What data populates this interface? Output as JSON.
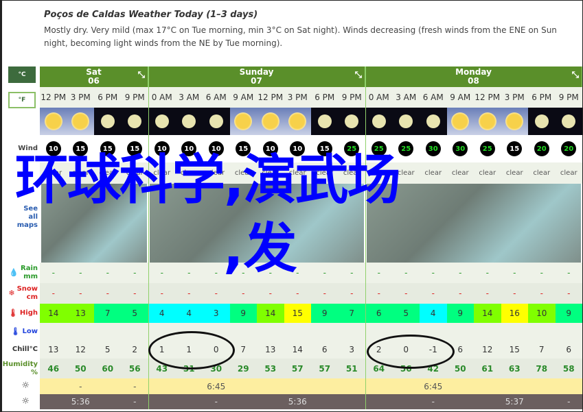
{
  "title": "Poços de Caldas Weather Today (1–3 days)",
  "description": "Mostly dry. Very mild (max 17°C on Tue morning, min 3°C on Sat night). Winds decreasing (fresh winds from the ENE on Sun night, becoming light winds from the NE by Tue morning).",
  "units": {
    "celsius": "°C",
    "fahrenheit": "°F"
  },
  "days": [
    {
      "name": "Sat",
      "date": "06"
    },
    {
      "name": "Sunday",
      "date": "07"
    },
    {
      "name": "Monday",
      "date": "08"
    }
  ],
  "times": [
    "12 PM",
    "3 PM",
    "6 PM",
    "9 PM",
    "0 AM",
    "3 AM",
    "6 AM",
    "9 AM",
    "12 PM",
    "3 PM",
    "6 PM",
    "9 PM",
    "0 AM",
    "3 AM",
    "6 AM",
    "9 AM",
    "12 PM",
    "3 PM",
    "6 PM",
    "9 PM"
  ],
  "sky": [
    "sun",
    "sun",
    "moon",
    "moon",
    "moon",
    "moon",
    "moon",
    "sun",
    "sun",
    "sun",
    "moon",
    "moon",
    "moon",
    "moon",
    "moon",
    "sun",
    "sun",
    "sun",
    "moon",
    "moon"
  ],
  "labels": {
    "wind": "Wind",
    "maps": "See all maps",
    "rain": "Rain mm",
    "snow": "Snow cm",
    "high": "High",
    "low": "Low",
    "chill": "Chill°C",
    "humidity": "Humidity %"
  },
  "wind": [
    10,
    15,
    15,
    15,
    10,
    10,
    10,
    15,
    10,
    10,
    15,
    25,
    25,
    25,
    30,
    30,
    25,
    15,
    20,
    20
  ],
  "summary": [
    "clear",
    "clear",
    "clear",
    "clear",
    "clear",
    "clear",
    "clear",
    "clear",
    "clear",
    "clear",
    "clear",
    "clear",
    "clear",
    "clear",
    "clear",
    "clear",
    "clear",
    "clear",
    "clear",
    "clear"
  ],
  "rain": [
    "-",
    "-",
    "-",
    "-",
    "-",
    "-",
    "-",
    "-",
    "-",
    "-",
    "-",
    "-",
    "-",
    "-",
    "-",
    "-",
    "-",
    "-",
    "-",
    "-"
  ],
  "snow": [
    "-",
    "-",
    "-",
    "-",
    "-",
    "-",
    "-",
    "-",
    "-",
    "-",
    "-",
    "-",
    "-",
    "-",
    "-",
    "-",
    "-",
    "-",
    "-",
    "-"
  ],
  "high": [
    14,
    13,
    7,
    5,
    4,
    4,
    3,
    9,
    14,
    15,
    9,
    7,
    6,
    5,
    4,
    9,
    14,
    16,
    10,
    9
  ],
  "chill": [
    13,
    12,
    5,
    2,
    1,
    1,
    0,
    7,
    13,
    14,
    6,
    3,
    2,
    0,
    -1,
    6,
    12,
    15,
    7,
    6
  ],
  "humidity": [
    46,
    50,
    60,
    56,
    43,
    31,
    30,
    29,
    53,
    57,
    57,
    51,
    64,
    56,
    42,
    50,
    61,
    63,
    78,
    58
  ],
  "sunrise": [
    "",
    "-",
    "",
    "-",
    "",
    "",
    "6:45",
    "",
    "",
    "",
    "",
    "",
    "",
    "",
    "6:45",
    "",
    "",
    "",
    "",
    ""
  ],
  "sunset": [
    "",
    "5:36",
    "",
    "-",
    "",
    "",
    "-",
    "",
    "",
    "5:36",
    "",
    "",
    "",
    "",
    "-",
    "",
    "",
    "5:37",
    "",
    "-"
  ],
  "overlay": {
    "line1": "环球科学,演武场",
    "line2": ",发"
  },
  "colors": {
    "header": "#5a8f2a",
    "overlay": "#0000ff"
  }
}
